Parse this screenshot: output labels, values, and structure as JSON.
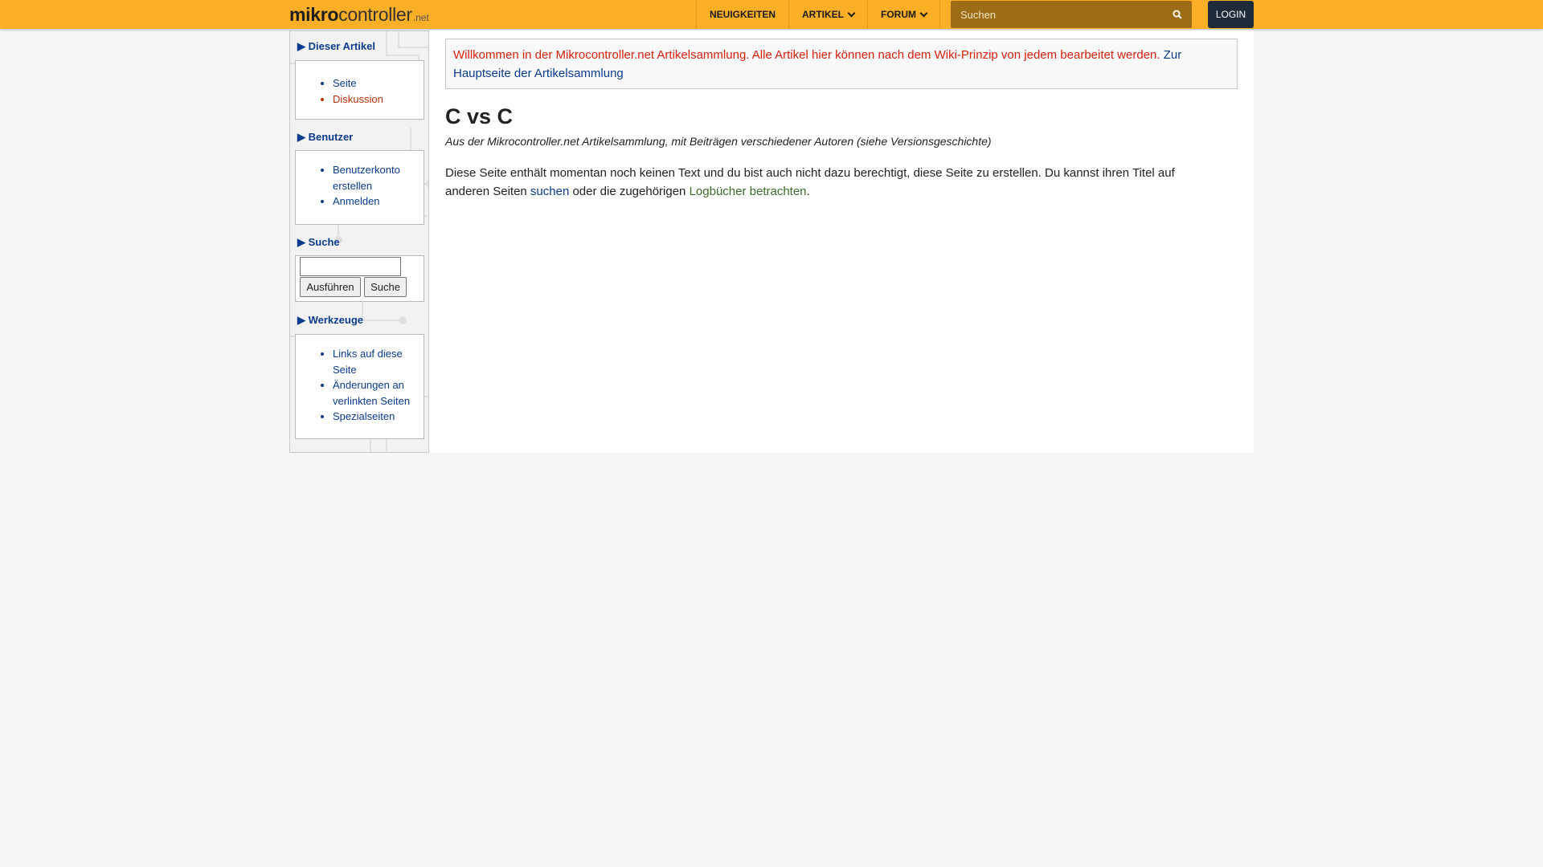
{
  "navbar": {
    "logo": {
      "part1": "mikro",
      "part2": "controller",
      "part3": ".net"
    },
    "items": [
      {
        "label": "NEUIGKEITEN",
        "has_dropdown": false
      },
      {
        "label": "ARTIKEL",
        "has_dropdown": true
      },
      {
        "label": "FORUM",
        "has_dropdown": true
      }
    ],
    "search": {
      "placeholder": "Suchen",
      "value": ""
    },
    "login_label": "LOGIN",
    "colors": {
      "bar": "#fbaf26",
      "login_bg": "#1f2b3a",
      "search_bg": "#9c6d15"
    }
  },
  "sidebar": {
    "dieser_artikel": {
      "heading": "▶ Dieser Artikel",
      "items": [
        "Seite",
        "Diskussion"
      ]
    },
    "benutzer": {
      "heading": "▶ Benutzer",
      "items": [
        "Benutzerkonto erstellen",
        "Anmelden"
      ]
    },
    "suche": {
      "heading": "▶ Suche",
      "input_value": "",
      "go_label": "Ausführen",
      "search_label": "Suche"
    },
    "werkzeuge": {
      "heading": "▶ Werkzeuge",
      "items": [
        "Links auf diese Seite",
        "Änderungen an verlinkten Seiten",
        "Spezialseiten"
      ]
    }
  },
  "content": {
    "notice": {
      "text": "Willkommen in der Mikrocontroller.net Artikelsammlung. Alle Artikel hier können nach dem Wiki-Prinzip von jedem bearbeitet werden.",
      "link": "Zur Hauptseite der Artikelsammlung"
    },
    "title": "C vs C",
    "subtitle": "Aus der Mikrocontroller.net Artikelsammlung, mit Beiträgen verschiedener Autoren (siehe Versionsgeschichte)",
    "body": {
      "part1": "Diese Seite enthält momentan noch keinen Text und du bist auch nicht dazu berechtigt, diese Seite zu erstellen. Du kannst ihren Titel auf anderen Seiten ",
      "link1": "suchen",
      "part2": " oder die zugehörigen ",
      "link2": "Logbücher betrachten",
      "part3": "."
    },
    "colors": {
      "notice_text": "#d8200d",
      "link": "#0b3b8c",
      "logbook_link": "#3d6b2a",
      "red_link": "#b5300b"
    }
  }
}
